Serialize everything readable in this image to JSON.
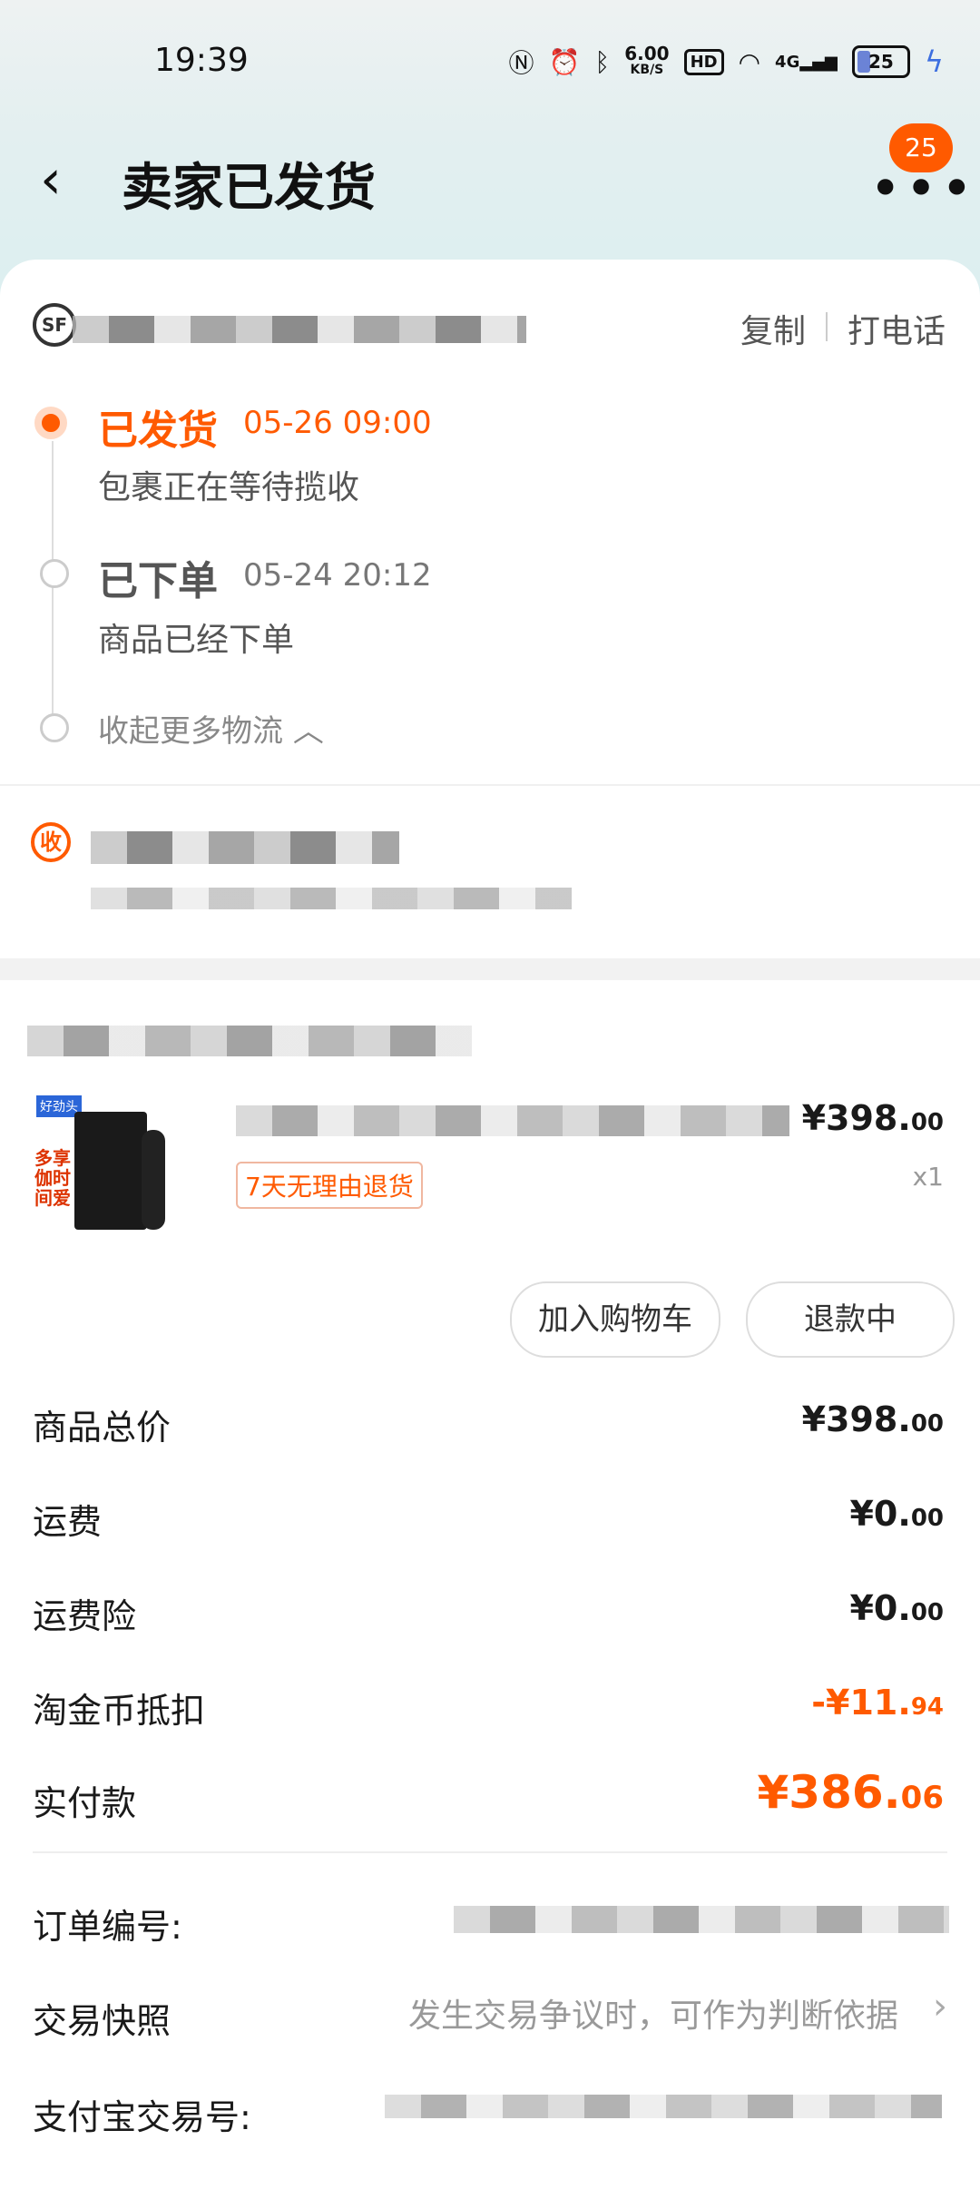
{
  "status_bar": {
    "time": "19:39",
    "net_speed": "6.00",
    "net_unit": "KB/S",
    "hd": "HD",
    "net_type": "4G",
    "battery": "25"
  },
  "header": {
    "title": "卖家已发货",
    "badge": "25"
  },
  "logistics": {
    "carrier_logo": "SF",
    "copy_label": "复制",
    "call_label": "打电话",
    "steps": [
      {
        "title": "已发货",
        "time": "05-26 09:00",
        "desc": "包裹正在等待揽收"
      },
      {
        "title": "已下单",
        "time": "05-24 20:12",
        "desc": "商品已经下单"
      }
    ],
    "collapse_label": "收起更多物流"
  },
  "receiver": {
    "icon_label": "收"
  },
  "product": {
    "image_text": "多享伽时间爱",
    "image_logo": "好劲头",
    "price_int": "¥398.",
    "price_dec": "00",
    "qty": "x1",
    "return_tag": "7天无理由退货"
  },
  "actions": {
    "add_cart": "加入购物车",
    "refund": "退款中"
  },
  "summary": {
    "rows": [
      {
        "label": "商品总价",
        "int": "¥398.",
        "dec": "00"
      },
      {
        "label": "运费",
        "int": "¥0.",
        "dec": "00"
      },
      {
        "label": "运费险",
        "int": "¥0.",
        "dec": "00"
      },
      {
        "label": "淘金币抵扣",
        "int": "-¥11.",
        "dec": "94"
      },
      {
        "label": "实付款",
        "int": "¥386.",
        "dec": "06"
      }
    ]
  },
  "order_info": {
    "order_no_label": "订单编号:",
    "snapshot_label": "交易快照",
    "snapshot_hint": "发生交易争议时，可作为判断依据",
    "alipay_label": "支付宝交易号:"
  },
  "colors": {
    "accent": "#ff5a00",
    "text": "#1a1a1a",
    "muted": "#777777"
  }
}
